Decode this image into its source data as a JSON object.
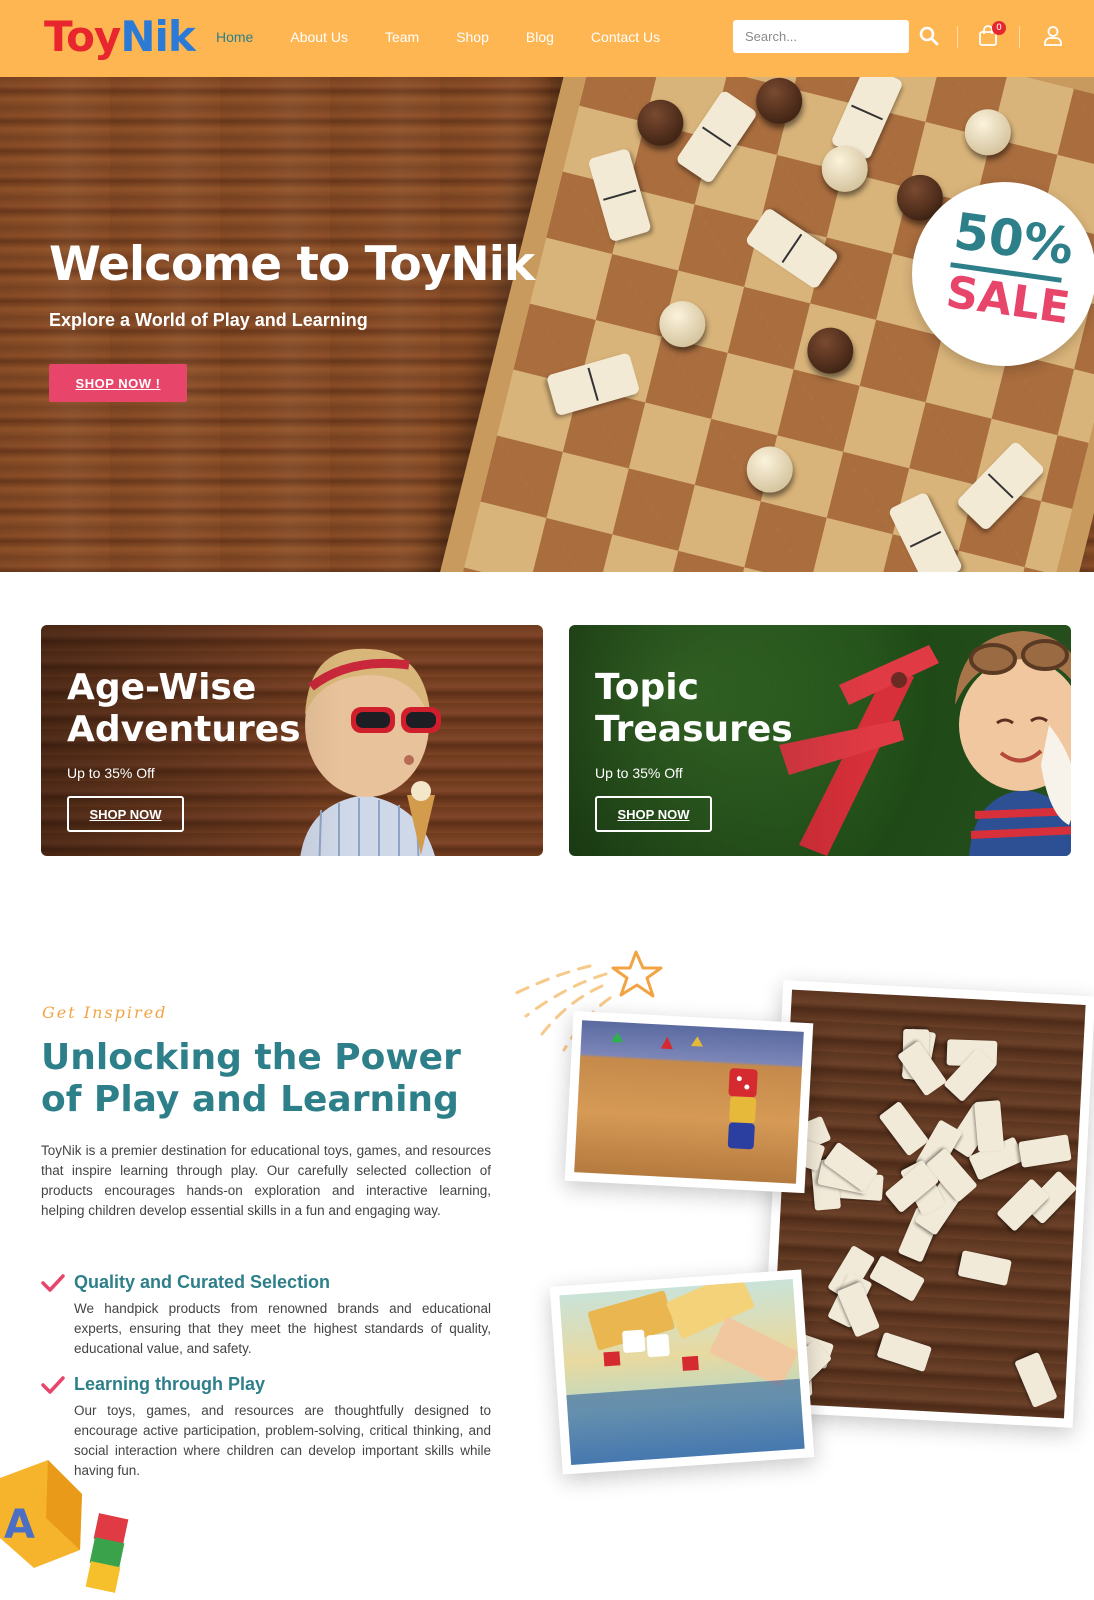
{
  "nav": {
    "logo_part1": "Toy",
    "logo_part2": "Nik",
    "items": [
      "Home",
      "About Us",
      "Team",
      "Shop",
      "Blog",
      "Contact Us"
    ],
    "active_item": "Home",
    "search_placeholder": "Search...",
    "cart_count": "0",
    "icons": [
      "search-icon",
      "cart-icon",
      "user-icon"
    ]
  },
  "hero": {
    "title": "Welcome to ToyNik",
    "subtitle": "Explore a World of Play and Learning",
    "button_label": "SHOP NOW !",
    "badge_percent": "50%",
    "badge_text": "SALE"
  },
  "promos": [
    {
      "title_line1": "Age-Wise",
      "title_line2": "Adventures",
      "subtitle": "Up to 35% Off",
      "button_label": "SHOP NOW"
    },
    {
      "title_line1": "Topic",
      "title_line2": "Treasures",
      "subtitle": "Up to 35% Off",
      "button_label": "SHOP NOW"
    }
  ],
  "inspired": {
    "eyebrow": "Get Inspired",
    "title": "Unlocking the Power of Play and Learning",
    "body": "ToyNik is a premier destination for educational toys, games, and resources that inspire learning through play. Our carefully selected collection of products encourages hands-on exploration and interactive learning, helping children develop essential skills in a fun and engaging way.",
    "features": [
      {
        "title": "Quality and Curated Selection",
        "body": "We handpick products from renowned brands and educational experts, ensuring that they meet the highest standards of quality, educational value, and safety."
      },
      {
        "title": "Learning through Play",
        "body": "Our toys, games, and resources are thoughtfully designed to encourage active participation, problem-solving, critical thinking, and social interaction where children can develop important skills while having fun."
      }
    ]
  },
  "colors": {
    "nav_bg": "#fdb652",
    "teal": "#2d7f8a",
    "pink": "#e8456b",
    "logo_red": "#e8262e",
    "logo_blue": "#2b7bd6",
    "eyebrow": "#f2a444"
  }
}
